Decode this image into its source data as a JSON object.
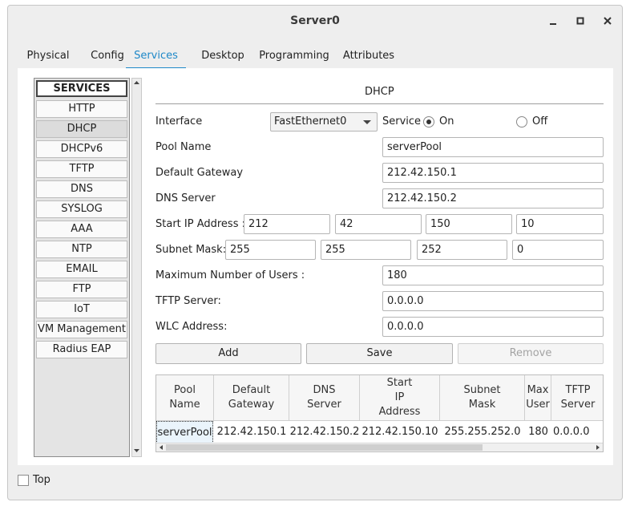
{
  "window": {
    "title": "Server0"
  },
  "tabs": [
    "Physical",
    "Config",
    "Services",
    "Desktop",
    "Programming",
    "Attributes"
  ],
  "active_tab": "Services",
  "services": {
    "header": "SERVICES",
    "items": [
      "HTTP",
      "DHCP",
      "DHCPv6",
      "TFTP",
      "DNS",
      "SYSLOG",
      "AAA",
      "NTP",
      "EMAIL",
      "FTP",
      "IoT",
      "VM Management",
      "Radius EAP"
    ],
    "selected": "DHCP"
  },
  "dhcp": {
    "title": "DHCP",
    "interface_label": "Interface",
    "interface_value": "FastEthernet0",
    "service_label": "Service",
    "on_label": "On",
    "off_label": "Off",
    "service_state": "On",
    "pool_name_label": "Pool Name",
    "pool_name": "serverPool",
    "default_gateway_label": "Default Gateway",
    "default_gateway": "212.42.150.1",
    "dns_server_label": "DNS Server",
    "dns_server": "212.42.150.2",
    "start_ip_label": "Start IP Address :",
    "start_ip": [
      "212",
      "42",
      "150",
      "10"
    ],
    "subnet_mask_label": "Subnet Mask:",
    "subnet_mask": [
      "255",
      "255",
      "252",
      "0"
    ],
    "max_users_label": "Maximum Number of Users :",
    "max_users": "180",
    "tftp_label": "TFTP Server:",
    "tftp": "0.0.0.0",
    "wlc_label": "WLC Address:",
    "wlc": "0.0.0.0",
    "buttons": {
      "add": "Add",
      "save": "Save",
      "remove": "Remove"
    }
  },
  "table": {
    "headers": [
      "Pool\nName",
      "Default\nGateway",
      "DNS\nServer",
      "Start\nIP\nAddress",
      "Subnet\nMask",
      "Max\nUser",
      "TFTP\nServer"
    ],
    "rows": [
      [
        "serverPool",
        "212.42.150.1",
        "212.42.150.2",
        "212.42.150.10",
        "255.255.252.0",
        "180",
        "0.0.0.0"
      ]
    ]
  },
  "footer": {
    "top_label": "Top",
    "top_checked": false
  }
}
